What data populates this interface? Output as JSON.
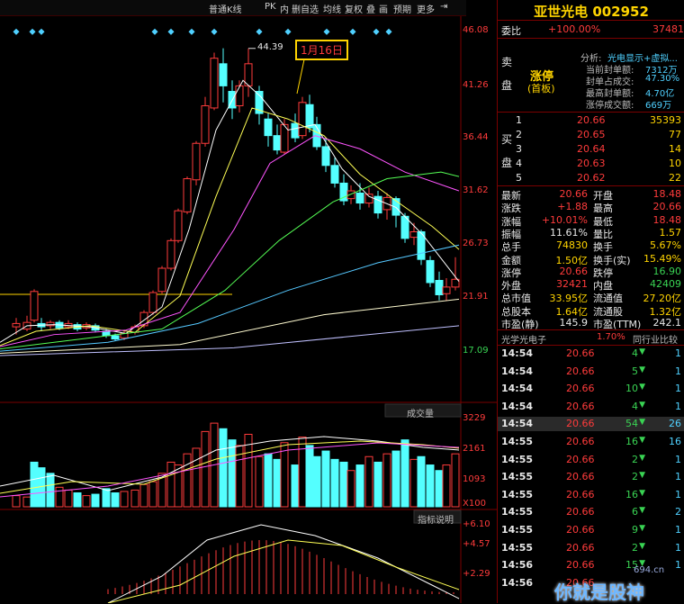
{
  "toolbar": {
    "items": [
      "普通K线",
      "PK",
      "内",
      "删自选",
      "均线",
      "复权",
      "叠",
      "画",
      "预期",
      "更多",
      "⇥"
    ]
  },
  "chart": {
    "price_ticks": [
      "46.08",
      "41.26",
      "36.44",
      "31.62",
      "26.73",
      "21.91",
      "17.09"
    ],
    "high_label": "44.39",
    "note": "1月16日",
    "vol_label": "成交量",
    "vol_ticks": [
      "3229",
      "2161",
      "1093",
      "X100"
    ],
    "ind_label": "指标说明",
    "ind_ticks": [
      "+6.10",
      "+4.57",
      "+2.29"
    ]
  },
  "quote": {
    "name": "亚世光电",
    "code": "002952",
    "weibi_label": "委比",
    "weibi": "+100.00%",
    "weicha": "37481",
    "sell_label1": "卖",
    "sell_label2": "盘",
    "zhangting": "涨停",
    "shouban": "(首板)",
    "analysis_title": "分析:",
    "analysis_sub": "光电显示+虚拟...",
    "analysis": [
      {
        "k": "当前封单额:",
        "v": "7312万"
      },
      {
        "k": "封单占成交:",
        "v": "47.30%"
      },
      {
        "k": "最高封单额:",
        "v": "4.70亿"
      },
      {
        "k": "涨停成交额:",
        "v": "669万"
      }
    ],
    "buy_label1": "买",
    "buy_label2": "盘",
    "bids": [
      {
        "n": "1",
        "p": "20.66",
        "v": "35393"
      },
      {
        "n": "2",
        "p": "20.65",
        "v": "77"
      },
      {
        "n": "3",
        "p": "20.64",
        "v": "14"
      },
      {
        "n": "4",
        "p": "20.63",
        "v": "10"
      },
      {
        "n": "5",
        "p": "20.62",
        "v": "22"
      }
    ],
    "stats": [
      {
        "l1": "最新",
        "v1": "20.66",
        "l2": "开盘",
        "v2": "18.48"
      },
      {
        "l1": "涨跌",
        "v1": "+1.88",
        "l2": "最高",
        "v2": "20.66"
      },
      {
        "l1": "涨幅",
        "v1": "+10.01%",
        "l2": "最低",
        "v2": "18.48"
      },
      {
        "l1": "振幅",
        "v1": "11.61%",
        "l2": "量比",
        "v2": "1.57"
      },
      {
        "l1": "总手",
        "v1": "74830",
        "l2": "换手",
        "v2": "5.67%"
      },
      {
        "l1": "金额",
        "v1": "1.50亿",
        "l2": "换手(实)",
        "v2": "15.49%"
      },
      {
        "l1": "涨停",
        "v1": "20.66",
        "l2": "跌停",
        "v2": "16.90"
      },
      {
        "l1": "外盘",
        "v1": "32421",
        "l2": "内盘",
        "v2": "42409"
      },
      {
        "l1": "总市值",
        "v1": "33.95亿",
        "l2": "流通值",
        "v2": "27.20亿"
      },
      {
        "l1": "总股本",
        "v1": "1.64亿",
        "l2": "流通股",
        "v2": "1.32亿"
      },
      {
        "l1": "市盈(静)",
        "v1": "145.9",
        "l2": "市盈(TTM)",
        "v2": "242.1"
      }
    ],
    "industry_name": "光学光电子",
    "industry_pct": "1.70%",
    "industry_cmp": "同行业比较",
    "ticks": [
      {
        "t": "14:54",
        "p": "20.66",
        "v": "4",
        "c": "1"
      },
      {
        "t": "14:54",
        "p": "20.66",
        "v": "5",
        "c": "1"
      },
      {
        "t": "14:54",
        "p": "20.66",
        "v": "10",
        "c": "1"
      },
      {
        "t": "14:54",
        "p": "20.66",
        "v": "4",
        "c": "1"
      },
      {
        "t": "14:54",
        "p": "20.66",
        "v": "54",
        "c": "26"
      },
      {
        "t": "14:55",
        "p": "20.66",
        "v": "16",
        "c": "16"
      },
      {
        "t": "14:55",
        "p": "20.66",
        "v": "2",
        "c": "1"
      },
      {
        "t": "14:55",
        "p": "20.66",
        "v": "2",
        "c": "1"
      },
      {
        "t": "14:55",
        "p": "20.66",
        "v": "16",
        "c": "1"
      },
      {
        "t": "14:55",
        "p": "20.66",
        "v": "6",
        "c": "2"
      },
      {
        "t": "14:55",
        "p": "20.66",
        "v": "9",
        "c": "1"
      },
      {
        "t": "14:55",
        "p": "20.66",
        "v": "2",
        "c": "1"
      },
      {
        "t": "14:56",
        "p": "20.66",
        "v": "15",
        "c": "1"
      },
      {
        "t": "14:56",
        "p": "20.66",
        "v": "",
        "c": ""
      }
    ]
  },
  "watermark": {
    "site": "694.cn",
    "text": "你就是股神"
  },
  "colors": {
    "up": "#ff3b3b",
    "down": "#54ffff",
    "ma5": "#ffffff",
    "ma10": "#ffff55",
    "ma20": "#ff55ff",
    "ma30": "#55ff55",
    "ma60": "#55c8ff"
  }
}
